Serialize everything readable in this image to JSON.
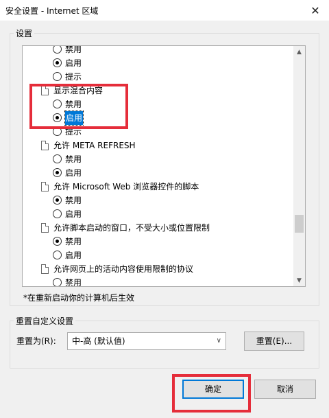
{
  "window": {
    "title": "安全设置 - Internet 区域",
    "close_glyph": "✕"
  },
  "settings_group": {
    "label": "设置"
  },
  "list": {
    "rows": [
      {
        "type": "radio",
        "checked": false,
        "label": "禁用"
      },
      {
        "type": "radio",
        "checked": true,
        "label": "启用"
      },
      {
        "type": "radio",
        "checked": false,
        "label": "提示"
      },
      {
        "type": "setting",
        "label": "显示混合内容"
      },
      {
        "type": "radio",
        "checked": false,
        "label": "禁用"
      },
      {
        "type": "radio",
        "checked": true,
        "label": "启用",
        "selected": true
      },
      {
        "type": "radio",
        "checked": false,
        "label": "提示"
      },
      {
        "type": "setting",
        "label": "允许 META REFRESH"
      },
      {
        "type": "radio",
        "checked": false,
        "label": "禁用"
      },
      {
        "type": "radio",
        "checked": true,
        "label": "启用"
      },
      {
        "type": "setting",
        "label": "允许 Microsoft Web 浏览器控件的脚本"
      },
      {
        "type": "radio",
        "checked": true,
        "label": "禁用"
      },
      {
        "type": "radio",
        "checked": false,
        "label": "启用"
      },
      {
        "type": "setting",
        "label": "允许脚本启动的窗口，不受大小或位置限制"
      },
      {
        "type": "radio",
        "checked": true,
        "label": "禁用"
      },
      {
        "type": "radio",
        "checked": false,
        "label": "启用"
      },
      {
        "type": "setting",
        "label": "允许网页上的活动内容使用限制的协议"
      },
      {
        "type": "radio",
        "checked": false,
        "label": "禁用"
      }
    ]
  },
  "note": "*在重新启动你的计算机后生效",
  "reset_group": {
    "label": "重置自定义设置",
    "reset_to_label": "重置为(R):",
    "combo_value": "中-高 (默认值)",
    "reset_button": "重置(E)..."
  },
  "footer": {
    "ok": "确定",
    "cancel": "取消"
  },
  "colors": {
    "highlight_box": "#e52d3a",
    "selection": "#0078d7"
  }
}
